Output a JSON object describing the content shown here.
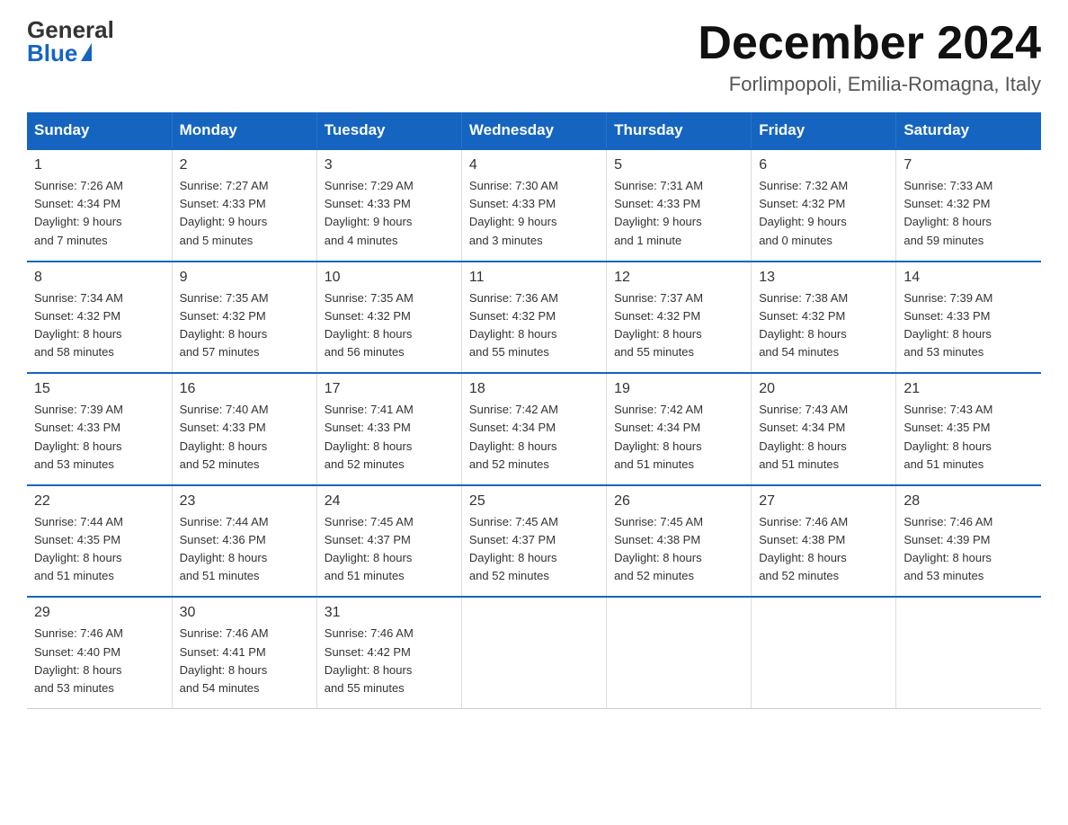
{
  "logo": {
    "general": "General",
    "blue": "Blue"
  },
  "title": "December 2024",
  "location": "Forlimpopoli, Emilia-Romagna, Italy",
  "days_of_week": [
    "Sunday",
    "Monday",
    "Tuesday",
    "Wednesday",
    "Thursday",
    "Friday",
    "Saturday"
  ],
  "weeks": [
    [
      {
        "day": "1",
        "sunrise": "7:26 AM",
        "sunset": "4:34 PM",
        "daylight": "9 hours and 7 minutes."
      },
      {
        "day": "2",
        "sunrise": "7:27 AM",
        "sunset": "4:33 PM",
        "daylight": "9 hours and 5 minutes."
      },
      {
        "day": "3",
        "sunrise": "7:29 AM",
        "sunset": "4:33 PM",
        "daylight": "9 hours and 4 minutes."
      },
      {
        "day": "4",
        "sunrise": "7:30 AM",
        "sunset": "4:33 PM",
        "daylight": "9 hours and 3 minutes."
      },
      {
        "day": "5",
        "sunrise": "7:31 AM",
        "sunset": "4:33 PM",
        "daylight": "9 hours and 1 minute."
      },
      {
        "day": "6",
        "sunrise": "7:32 AM",
        "sunset": "4:32 PM",
        "daylight": "9 hours and 0 minutes."
      },
      {
        "day": "7",
        "sunrise": "7:33 AM",
        "sunset": "4:32 PM",
        "daylight": "8 hours and 59 minutes."
      }
    ],
    [
      {
        "day": "8",
        "sunrise": "7:34 AM",
        "sunset": "4:32 PM",
        "daylight": "8 hours and 58 minutes."
      },
      {
        "day": "9",
        "sunrise": "7:35 AM",
        "sunset": "4:32 PM",
        "daylight": "8 hours and 57 minutes."
      },
      {
        "day": "10",
        "sunrise": "7:35 AM",
        "sunset": "4:32 PM",
        "daylight": "8 hours and 56 minutes."
      },
      {
        "day": "11",
        "sunrise": "7:36 AM",
        "sunset": "4:32 PM",
        "daylight": "8 hours and 55 minutes."
      },
      {
        "day": "12",
        "sunrise": "7:37 AM",
        "sunset": "4:32 PM",
        "daylight": "8 hours and 55 minutes."
      },
      {
        "day": "13",
        "sunrise": "7:38 AM",
        "sunset": "4:32 PM",
        "daylight": "8 hours and 54 minutes."
      },
      {
        "day": "14",
        "sunrise": "7:39 AM",
        "sunset": "4:33 PM",
        "daylight": "8 hours and 53 minutes."
      }
    ],
    [
      {
        "day": "15",
        "sunrise": "7:39 AM",
        "sunset": "4:33 PM",
        "daylight": "8 hours and 53 minutes."
      },
      {
        "day": "16",
        "sunrise": "7:40 AM",
        "sunset": "4:33 PM",
        "daylight": "8 hours and 52 minutes."
      },
      {
        "day": "17",
        "sunrise": "7:41 AM",
        "sunset": "4:33 PM",
        "daylight": "8 hours and 52 minutes."
      },
      {
        "day": "18",
        "sunrise": "7:42 AM",
        "sunset": "4:34 PM",
        "daylight": "8 hours and 52 minutes."
      },
      {
        "day": "19",
        "sunrise": "7:42 AM",
        "sunset": "4:34 PM",
        "daylight": "8 hours and 51 minutes."
      },
      {
        "day": "20",
        "sunrise": "7:43 AM",
        "sunset": "4:34 PM",
        "daylight": "8 hours and 51 minutes."
      },
      {
        "day": "21",
        "sunrise": "7:43 AM",
        "sunset": "4:35 PM",
        "daylight": "8 hours and 51 minutes."
      }
    ],
    [
      {
        "day": "22",
        "sunrise": "7:44 AM",
        "sunset": "4:35 PM",
        "daylight": "8 hours and 51 minutes."
      },
      {
        "day": "23",
        "sunrise": "7:44 AM",
        "sunset": "4:36 PM",
        "daylight": "8 hours and 51 minutes."
      },
      {
        "day": "24",
        "sunrise": "7:45 AM",
        "sunset": "4:37 PM",
        "daylight": "8 hours and 51 minutes."
      },
      {
        "day": "25",
        "sunrise": "7:45 AM",
        "sunset": "4:37 PM",
        "daylight": "8 hours and 52 minutes."
      },
      {
        "day": "26",
        "sunrise": "7:45 AM",
        "sunset": "4:38 PM",
        "daylight": "8 hours and 52 minutes."
      },
      {
        "day": "27",
        "sunrise": "7:46 AM",
        "sunset": "4:38 PM",
        "daylight": "8 hours and 52 minutes."
      },
      {
        "day": "28",
        "sunrise": "7:46 AM",
        "sunset": "4:39 PM",
        "daylight": "8 hours and 53 minutes."
      }
    ],
    [
      {
        "day": "29",
        "sunrise": "7:46 AM",
        "sunset": "4:40 PM",
        "daylight": "8 hours and 53 minutes."
      },
      {
        "day": "30",
        "sunrise": "7:46 AM",
        "sunset": "4:41 PM",
        "daylight": "8 hours and 54 minutes."
      },
      {
        "day": "31",
        "sunrise": "7:46 AM",
        "sunset": "4:42 PM",
        "daylight": "8 hours and 55 minutes."
      },
      null,
      null,
      null,
      null
    ]
  ],
  "labels": {
    "sunrise": "Sunrise:",
    "sunset": "Sunset:",
    "daylight": "Daylight:"
  }
}
